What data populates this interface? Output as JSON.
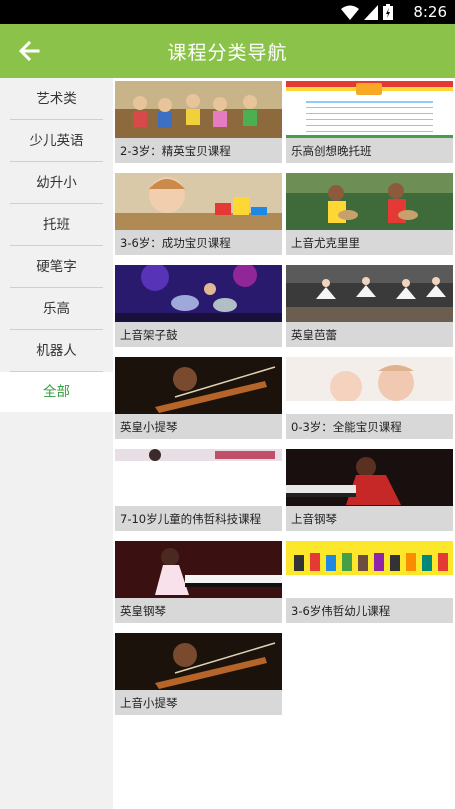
{
  "status_bar": {
    "time": "8:26"
  },
  "header": {
    "title": "课程分类导航",
    "back_icon": "arrow-left-icon"
  },
  "sidebar": {
    "items": [
      {
        "label": "艺术类",
        "active": false
      },
      {
        "label": "少儿英语",
        "active": false
      },
      {
        "label": "幼升小",
        "active": false
      },
      {
        "label": "托班",
        "active": false
      },
      {
        "label": "硬笔字",
        "active": false
      },
      {
        "label": "乐高",
        "active": false
      },
      {
        "label": "机器人",
        "active": false
      },
      {
        "label": "全部",
        "active": true
      }
    ]
  },
  "courses": [
    {
      "label": "2-3岁：精英宝贝课程"
    },
    {
      "label": "乐高创想晚托班"
    },
    {
      "label": "3-6岁：成功宝贝课程"
    },
    {
      "label": "上音尤克里里"
    },
    {
      "label": "上音架子鼓"
    },
    {
      "label": "英皇芭蕾"
    },
    {
      "label": "英皇小提琴"
    },
    {
      "label": "0-3岁：全能宝贝课程"
    },
    {
      "label": "7-10岁儿童的伟哲科技课程"
    },
    {
      "label": "上音钢琴"
    },
    {
      "label": "英皇钢琴"
    },
    {
      "label": "3-6岁伟哲幼儿课程"
    },
    {
      "label": "上音小提琴"
    }
  ],
  "colors": {
    "accent": "#8bc34a",
    "active_text": "#2e9d37",
    "sidebar_bg": "#f1f1f1",
    "card_label_bg": "#d8d8d8"
  }
}
